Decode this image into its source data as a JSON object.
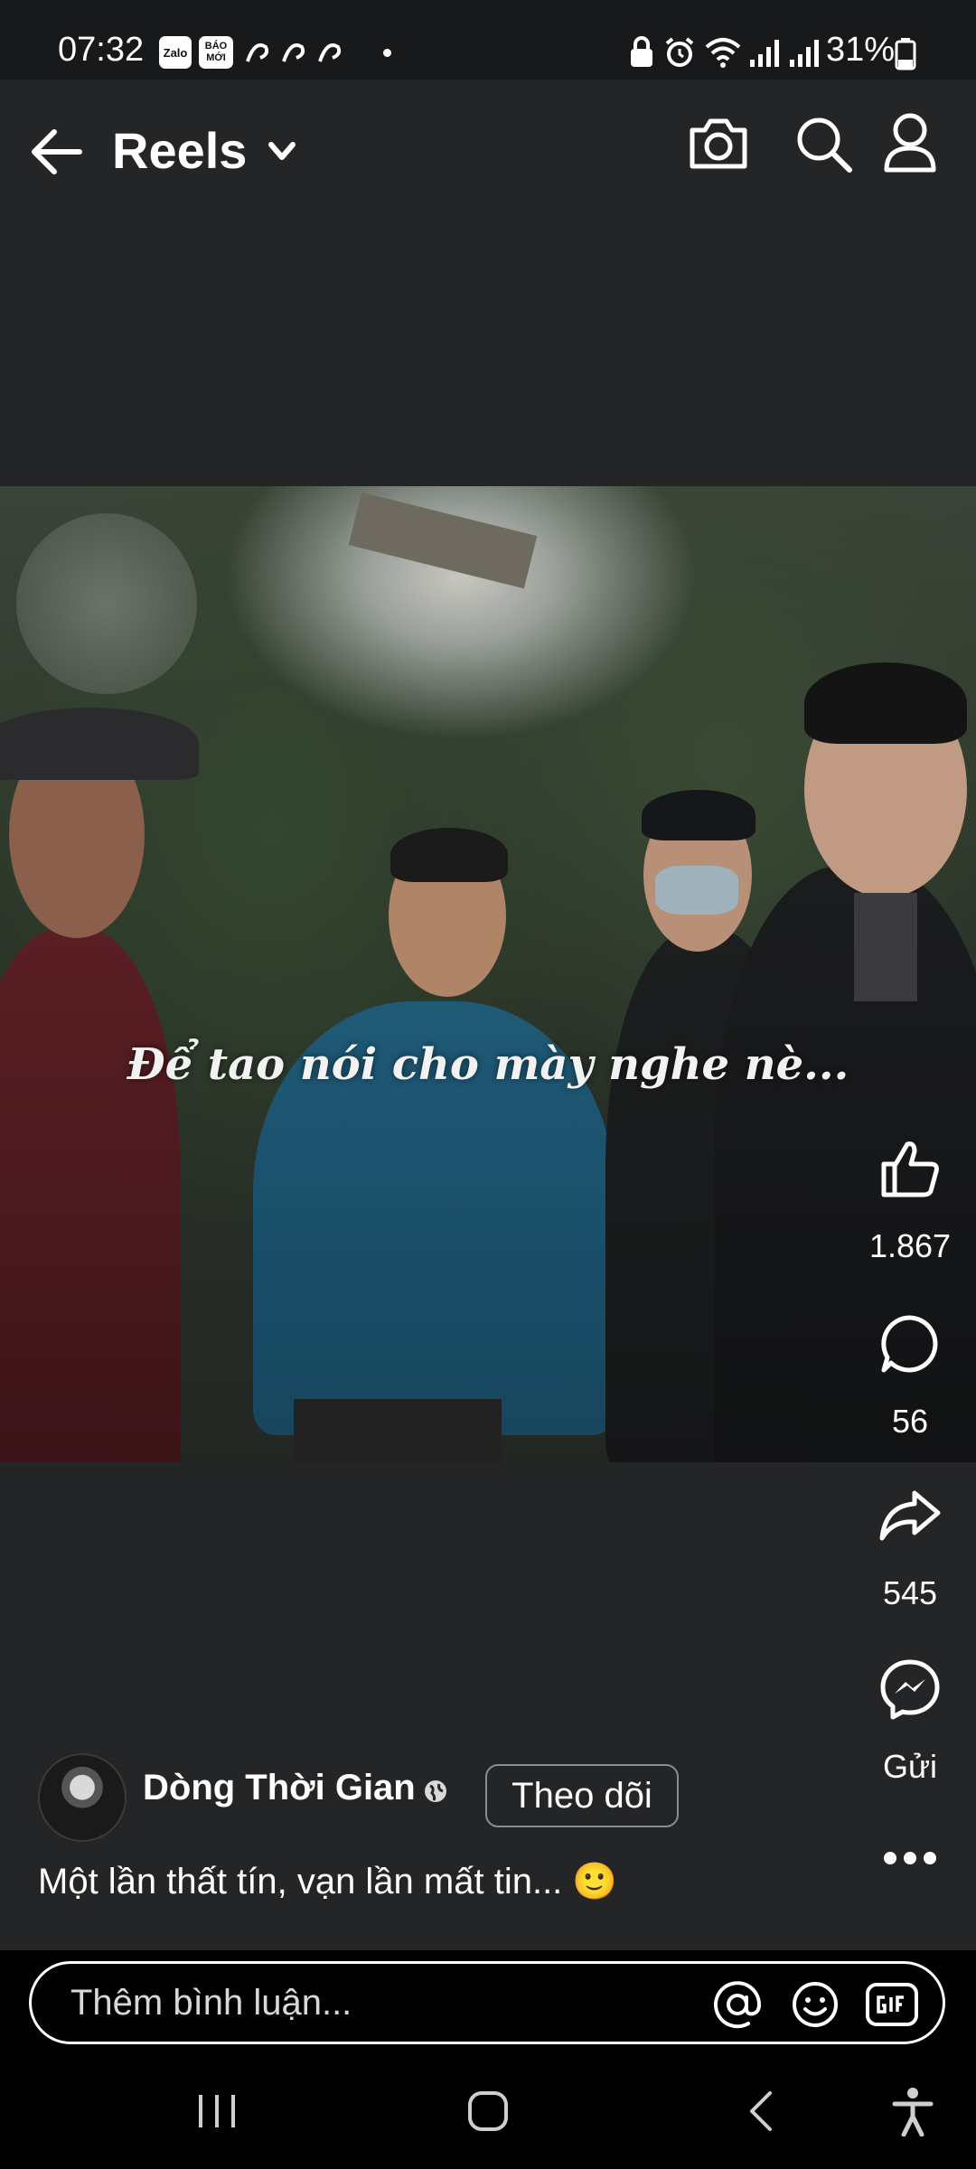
{
  "status_bar": {
    "time": "07:32",
    "app_badges": [
      "Zalo",
      "BÁO MỚI"
    ],
    "battery": "31%",
    "icons": [
      "lock-icon",
      "alarm-icon",
      "wifi-icon",
      "signal-icon",
      "signal-icon",
      "battery-icon"
    ]
  },
  "header": {
    "title": "Reels",
    "icons": [
      "back-arrow-icon",
      "chevron-down-icon",
      "camera-icon",
      "search-icon",
      "profile-icon"
    ]
  },
  "video": {
    "caption": "Để tao nói cho mày nghe nè..."
  },
  "actions": {
    "like_count": "1.867",
    "comment_count": "56",
    "share_count": "545",
    "send_label": "Gửi"
  },
  "author": {
    "name": "Dòng Thời Gian",
    "follow_label": "Theo dõi"
  },
  "post": {
    "caption": "Một lần thất tín, vạn lần mất tin...",
    "emoji": "🙂"
  },
  "comment_bar": {
    "placeholder": "Thêm bình luận..."
  },
  "colors": {
    "background": "#242527",
    "text": "#ffffff",
    "border": "#8a8d91"
  }
}
